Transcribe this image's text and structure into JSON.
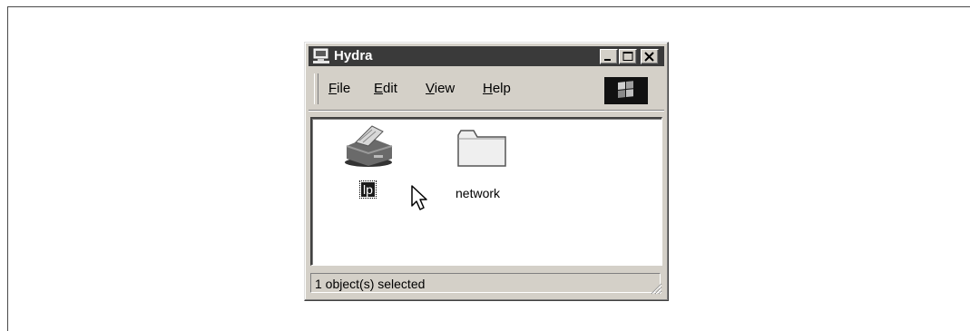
{
  "window": {
    "title": "Hydra",
    "controls": {
      "minimize_icon": "minimize-icon",
      "maximize_icon": "maximize-icon",
      "close_icon": "close-icon"
    }
  },
  "menu": {
    "items": [
      {
        "accel": "F",
        "rest": "ile"
      },
      {
        "accel": "E",
        "rest": "dit"
      },
      {
        "accel": "V",
        "rest": "iew"
      },
      {
        "accel": "H",
        "rest": "elp"
      }
    ],
    "logo_icon": "windows-logo-icon"
  },
  "content": {
    "items": [
      {
        "label": "lp",
        "icon": "printer-icon",
        "selected": true
      },
      {
        "label": "network",
        "icon": "folder-icon",
        "selected": false
      }
    ]
  },
  "status": {
    "text": "1 object(s) selected"
  },
  "colors": {
    "titlebar": "#3a3a3a",
    "face": "#d4d0c8",
    "content_bg": "#ffffff"
  }
}
